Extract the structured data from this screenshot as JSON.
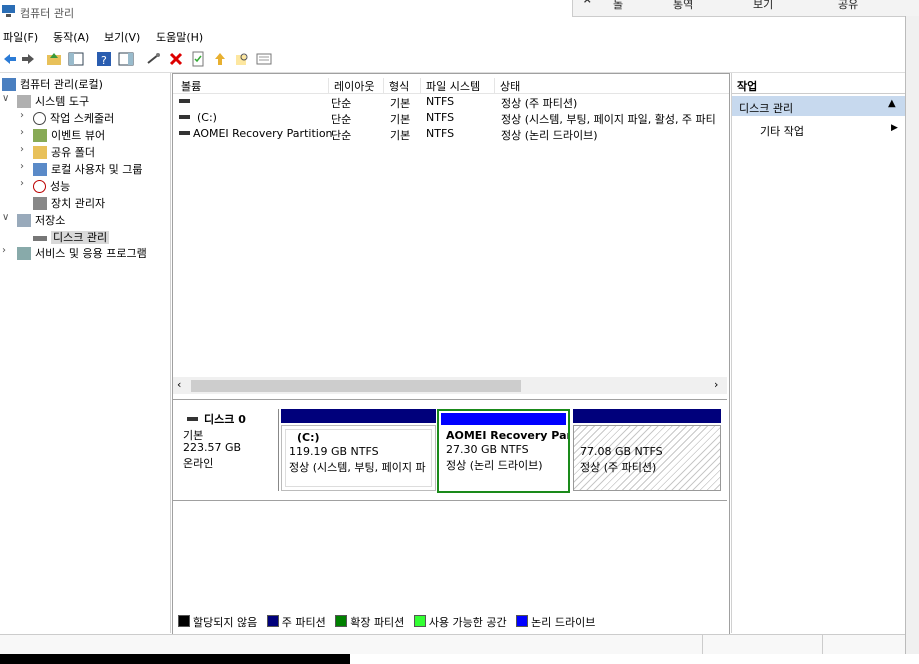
{
  "window": {
    "title": "컴퓨터 관리"
  },
  "overlay": {
    "items": [
      "돌",
      "통역",
      "보기",
      "공유"
    ]
  },
  "menu": {
    "items": [
      "파일(F)",
      "동작(A)",
      "보기(V)",
      "도움말(H)"
    ]
  },
  "tree": {
    "root": "컴퓨터 관리(로컬)",
    "system_tools": "시스템 도구",
    "task_scheduler": "작업 스케줄러",
    "event_viewer": "이벤트 뷰어",
    "shared_folders": "공유 폴더",
    "local_users": "로컬 사용자 및 그룹",
    "performance": "성능",
    "device_manager": "장치 관리자",
    "storage": "저장소",
    "disk_management": "디스크 관리",
    "services": "서비스 및 응용 프로그램"
  },
  "volumes": {
    "columns": [
      "볼륨",
      "레이아웃",
      "형식",
      "파일 시스템",
      "상태"
    ],
    "rows": [
      {
        "name": "",
        "layout": "단순",
        "type": "기본",
        "fs": "NTFS",
        "status": "정상 (주 파티션)"
      },
      {
        "name": "(C:)",
        "layout": "단순",
        "type": "기본",
        "fs": "NTFS",
        "status": "정상 (시스템, 부팅, 페이지 파일, 활성, 주 파티"
      },
      {
        "name": "AOMEI Recovery Partition",
        "layout": "단순",
        "type": "기본",
        "fs": "NTFS",
        "status": "정상 (논리 드라이브)"
      }
    ]
  },
  "disk": {
    "name": "디스크 0",
    "type": "기본",
    "size": "223.57 GB",
    "state": "온라인",
    "partitions": [
      {
        "label": "(C:)",
        "size": "119.19 GB NTFS",
        "status": "정상 (시스템, 부팅, 페이지 파"
      },
      {
        "label": "AOMEI Recovery Part",
        "size": "27.30 GB NTFS",
        "status": "정상 (논리 드라이브)"
      },
      {
        "label": "",
        "size": "77.08 GB NTFS",
        "status": "정상 (주 파티션)"
      }
    ]
  },
  "legend": [
    "할당되지 않음",
    "주 파티션",
    "확장 파티션",
    "사용 가능한 공간",
    "논리 드라이브"
  ],
  "legend_colors": [
    "#000000",
    "#00007b",
    "#008000",
    "#33ff33",
    "#0000ff"
  ],
  "actions": {
    "title": "작업",
    "group": "디스크 관리",
    "more": "기타 작업"
  }
}
